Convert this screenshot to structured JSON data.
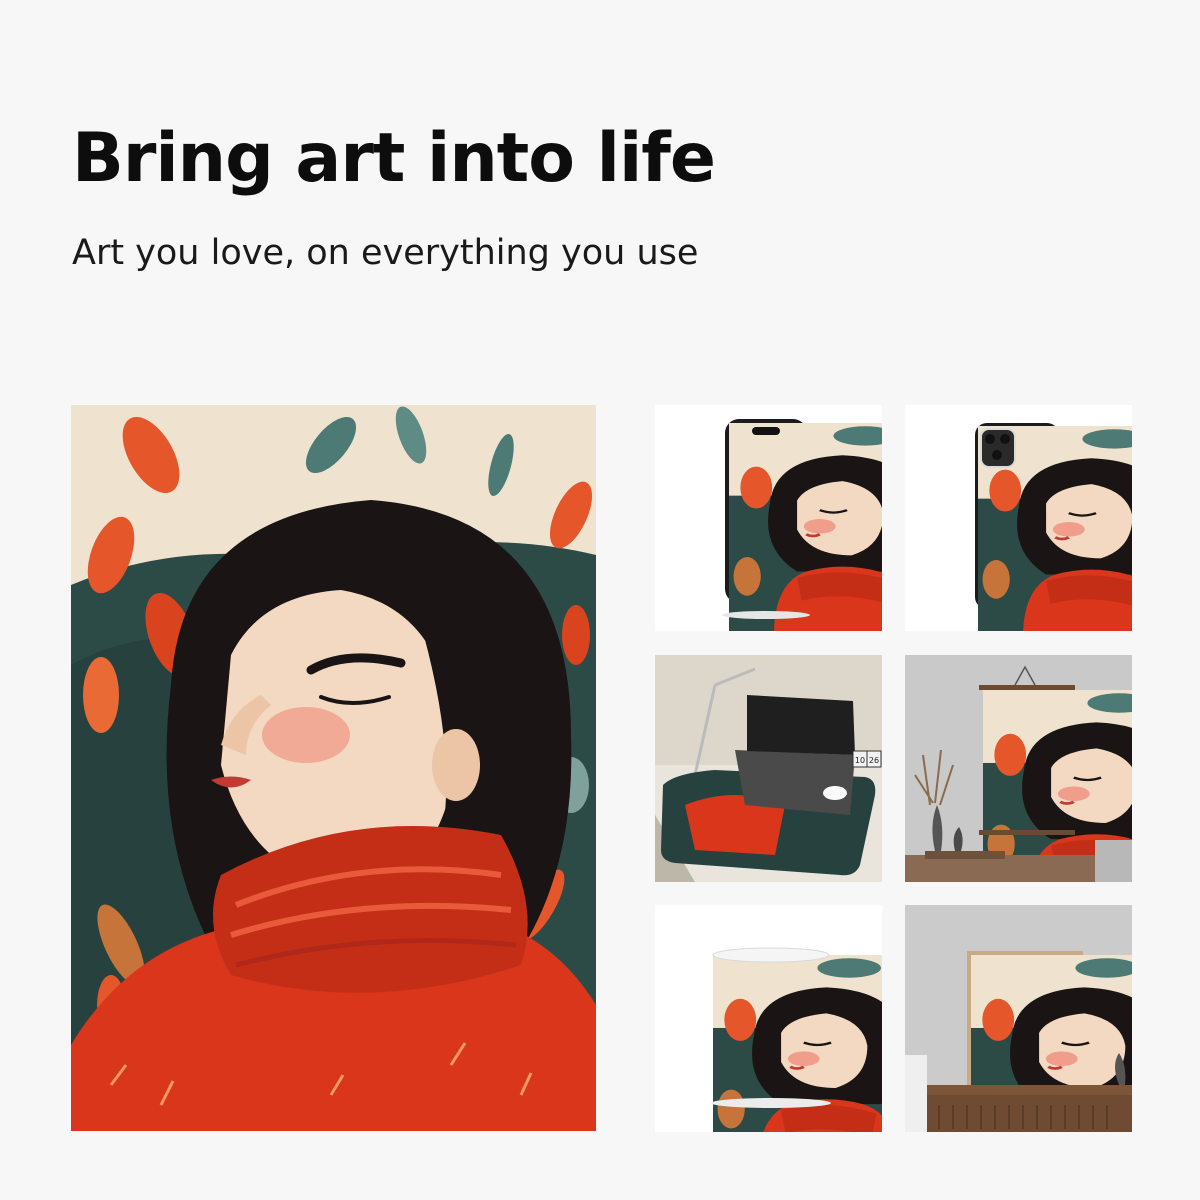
{
  "header": {
    "title": "Bring art into life",
    "subtitle": "Art you love, on everything you use"
  },
  "mockups": {
    "calendar_digits": [
      "10",
      "26"
    ]
  },
  "colors": {
    "background": "#f7f7f7",
    "sweater_red": "#d9361c",
    "hair_black": "#1a1514",
    "skin": "#f3d9c2",
    "backdrop_teal": "#2c4a46",
    "leaf_orange": "#e5572a"
  }
}
